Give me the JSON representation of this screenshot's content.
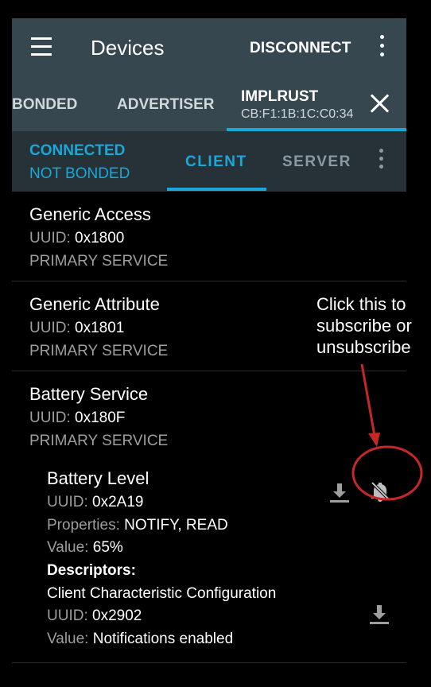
{
  "app_bar": {
    "title": "Devices",
    "disconnect_label": "DISCONNECT"
  },
  "device_tabs": {
    "bonded": "BONDED",
    "advertiser": "ADVERTISER",
    "active_name": "IMPLRUST",
    "active_address": "CB:F1:1B:1C:C0:34"
  },
  "status": {
    "connection": "CONNECTED",
    "bond": "NOT BONDED"
  },
  "sub_tabs": {
    "client": "CLIENT",
    "server": "SERVER"
  },
  "labels": {
    "uuid": "UUID:",
    "properties": "Properties:",
    "value": "Value:",
    "descriptors": "Descriptors:"
  },
  "services": [
    {
      "name": "Generic Access",
      "uuid": "0x1800",
      "type": "PRIMARY SERVICE"
    },
    {
      "name": "Generic Attribute",
      "uuid": "0x1801",
      "type": "PRIMARY SERVICE"
    },
    {
      "name": "Battery Service",
      "uuid": "0x180F",
      "type": "PRIMARY SERVICE"
    }
  ],
  "characteristic": {
    "name": "Battery Level",
    "uuid": "0x2A19",
    "properties": "NOTIFY, READ",
    "value": "65%",
    "descriptor": {
      "name": "Client Characteristic Configuration",
      "uuid": "0x2902",
      "value": "Notifications enabled"
    }
  },
  "annotation": {
    "line1": "Click this to",
    "line2": "subscribe or",
    "line3": "unsubscribe"
  },
  "colors": {
    "app_bar": "#37474f",
    "sub_bar": "#263238",
    "accent": "#19a8d8",
    "annotation_red": "#c62828"
  },
  "icons": [
    "menu-icon",
    "more-vert-icon",
    "close-icon",
    "download-icon",
    "notifications-off-icon"
  ]
}
